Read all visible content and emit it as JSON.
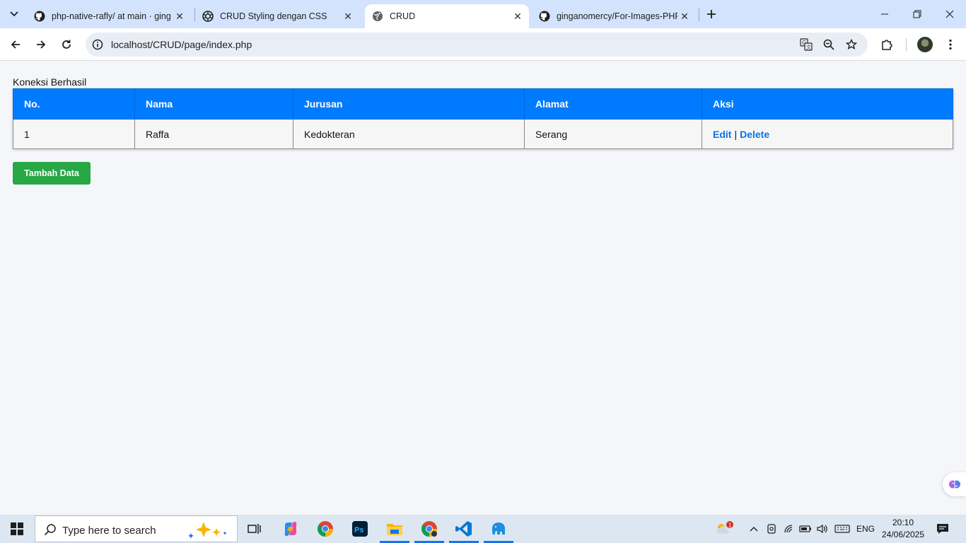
{
  "browser": {
    "tabs": [
      {
        "title": "php-native-rafly/ at main · ging",
        "favicon": "github-icon",
        "active": false
      },
      {
        "title": "CRUD Styling dengan CSS",
        "favicon": "openai-icon",
        "active": false
      },
      {
        "title": "CRUD",
        "favicon": "globe-icon",
        "active": true
      },
      {
        "title": "ginganomercy/For-Images-PHP",
        "favicon": "github-icon",
        "active": false
      }
    ],
    "url": "localhost/CRUD/page/index.php"
  },
  "page": {
    "status_message": "Koneksi Berhasil",
    "table": {
      "headers": [
        "No.",
        "Nama",
        "Jurusan",
        "Alamat",
        "Aksi"
      ],
      "rows": [
        {
          "no": "1",
          "nama": "Raffa",
          "jurusan": "Kedokteran",
          "alamat": "Serang",
          "edit_label": "Edit",
          "separator": "|",
          "delete_label": "Delete"
        }
      ]
    },
    "add_button_label": "Tambah Data"
  },
  "colors": {
    "header_bg": "#007bff",
    "action_link": "#0a73e6",
    "add_button": "#28a745",
    "page_bg": "#f4f6f9"
  },
  "taskbar": {
    "search_placeholder": "Type here to search",
    "weather_badge": "1",
    "language": "ENG",
    "time": "20:10",
    "date": "24/06/2025"
  }
}
